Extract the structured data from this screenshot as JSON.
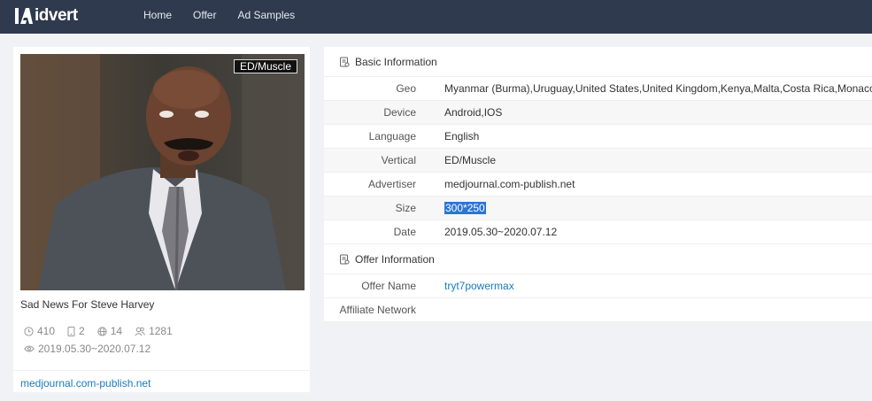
{
  "brand": {
    "logo_text": "idvert"
  },
  "nav": [
    {
      "label": "Home"
    },
    {
      "label": "Offer"
    },
    {
      "label": "Ad Samples"
    }
  ],
  "ad": {
    "badge": "ED/Muscle",
    "title": "Sad News For Steve Harvey",
    "stats": {
      "views": "410",
      "devices": "2",
      "geos": "14",
      "users": "1281"
    },
    "date_range": "2019.05.30~2020.07.12",
    "domain": "medjournal.com-publish.net"
  },
  "basic_info": {
    "title": "Basic Information",
    "rows": [
      {
        "key": "Geo",
        "value": "Myanmar (Burma),Uruguay,United States,United Kingdom,Kenya,Malta,Costa Rica,Monaco"
      },
      {
        "key": "Device",
        "value": "Android,IOS"
      },
      {
        "key": "Language",
        "value": "English"
      },
      {
        "key": "Vertical",
        "value": "ED/Muscle"
      },
      {
        "key": "Advertiser",
        "value": "medjournal.com-publish.net"
      },
      {
        "key": "Size",
        "value": "300*250"
      },
      {
        "key": "Date",
        "value": "2019.05.30~2020.07.12"
      }
    ]
  },
  "offer_info": {
    "title": "Offer Information",
    "rows": [
      {
        "key": "Offer Name",
        "value": "tryt7powermax"
      },
      {
        "key": "Affiliate Network",
        "value": ""
      }
    ]
  }
}
